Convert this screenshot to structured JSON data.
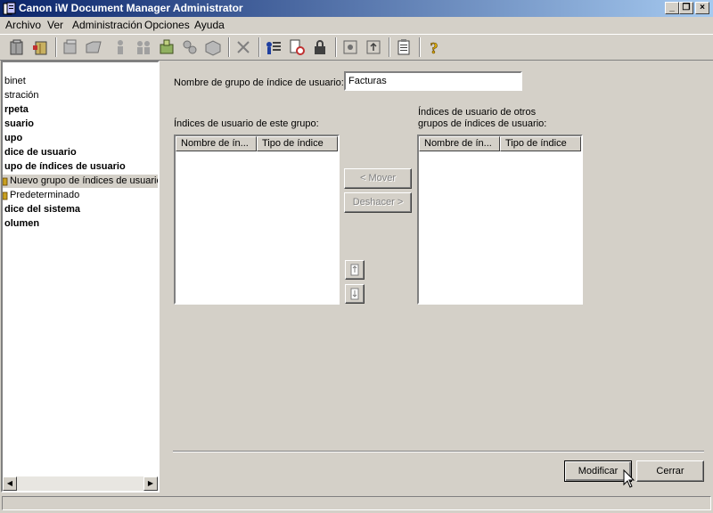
{
  "window": {
    "title": "Canon iW Document Manager Administrator",
    "controls": [
      "_",
      "❐",
      "×"
    ]
  },
  "menu": [
    "Archivo",
    "Ver",
    "Administración",
    "Opciones",
    "Ayuda"
  ],
  "tree": {
    "items": [
      {
        "label": "binet",
        "bold": false,
        "icon": false,
        "selected": false
      },
      {
        "label": "stración",
        "bold": false,
        "icon": false,
        "selected": false
      },
      {
        "label": "rpeta",
        "bold": true,
        "icon": false,
        "selected": false
      },
      {
        "label": "suario",
        "bold": true,
        "icon": false,
        "selected": false
      },
      {
        "label": "upo",
        "bold": true,
        "icon": false,
        "selected": false
      },
      {
        "label": "dice de usuario",
        "bold": true,
        "icon": false,
        "selected": false
      },
      {
        "label": "upo de índices de usuario",
        "bold": true,
        "icon": false,
        "selected": false
      },
      {
        "label": "Nuevo grupo de índices de usuario",
        "bold": false,
        "icon": true,
        "selected": true
      },
      {
        "label": "Predeterminado",
        "bold": false,
        "icon": true,
        "selected": false
      },
      {
        "label": "dice del sistema",
        "bold": true,
        "icon": false,
        "selected": false
      },
      {
        "label": "olumen",
        "bold": true,
        "icon": false,
        "selected": false
      }
    ],
    "scroll_left": "◀",
    "scroll_right": "▶"
  },
  "form": {
    "group_name_label": "Nombre de grupo de índice de usuario:",
    "group_name_value": "Facturas",
    "this_group_label": "Índices de usuario de este grupo:",
    "other_groups_label_line1": "Índices de usuario de otros",
    "other_groups_label_line2": "grupos de índices de usuario:",
    "columns": [
      "Nombre de ín...",
      "Tipo de índice"
    ],
    "move_button": "< Mover",
    "undo_button": "Deshacer >",
    "modify_button": "Modificar",
    "close_button": "Cerrar"
  }
}
